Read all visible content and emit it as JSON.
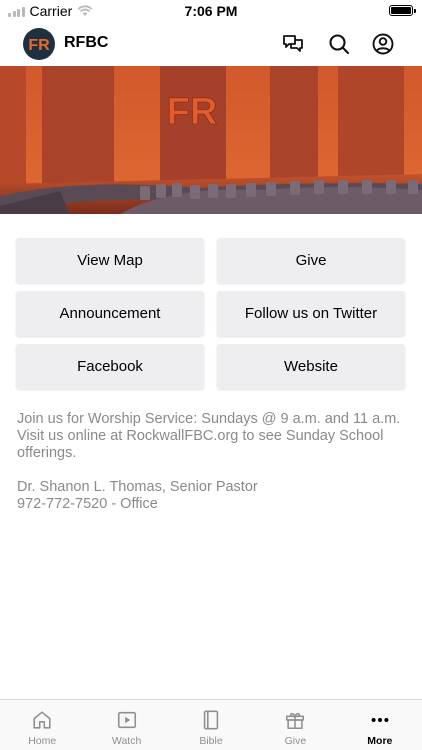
{
  "status_bar": {
    "carrier": "Carrier",
    "time": "7:06 PM"
  },
  "header": {
    "title": "RFBC",
    "logo_letters": "FR",
    "icons": [
      "chat-icon",
      "search-icon",
      "profile-icon"
    ]
  },
  "hero": {
    "sign_letters": "FR"
  },
  "buttons": [
    {
      "label": "View Map"
    },
    {
      "label": "Give"
    },
    {
      "label": "Announcement"
    },
    {
      "label": "Follow us on Twitter"
    },
    {
      "label": "Facebook"
    },
    {
      "label": "Website"
    }
  ],
  "info": {
    "lines": [
      "Join us for Worship Service: Sundays @ 9 a.m. and 11 a.m.",
      "Visit us online at RockwallFBC.org to see Sunday School",
      "offerings.",
      "",
      "Dr. Shanon L. Thomas, Senior Pastor",
      "972-772-7520 - Office"
    ]
  },
  "tabs": [
    {
      "label": "Home",
      "icon": "home-icon"
    },
    {
      "label": "Watch",
      "icon": "play-icon"
    },
    {
      "label": "Bible",
      "icon": "book-icon"
    },
    {
      "label": "Give",
      "icon": "gift-icon"
    },
    {
      "label": "More",
      "icon": "more-icon",
      "active": true
    }
  ],
  "colors": {
    "accent": "#e8692a",
    "logo_bg": "#1f3040",
    "button_bg": "#eeeef0",
    "info_text": "#8a8a8e"
  }
}
